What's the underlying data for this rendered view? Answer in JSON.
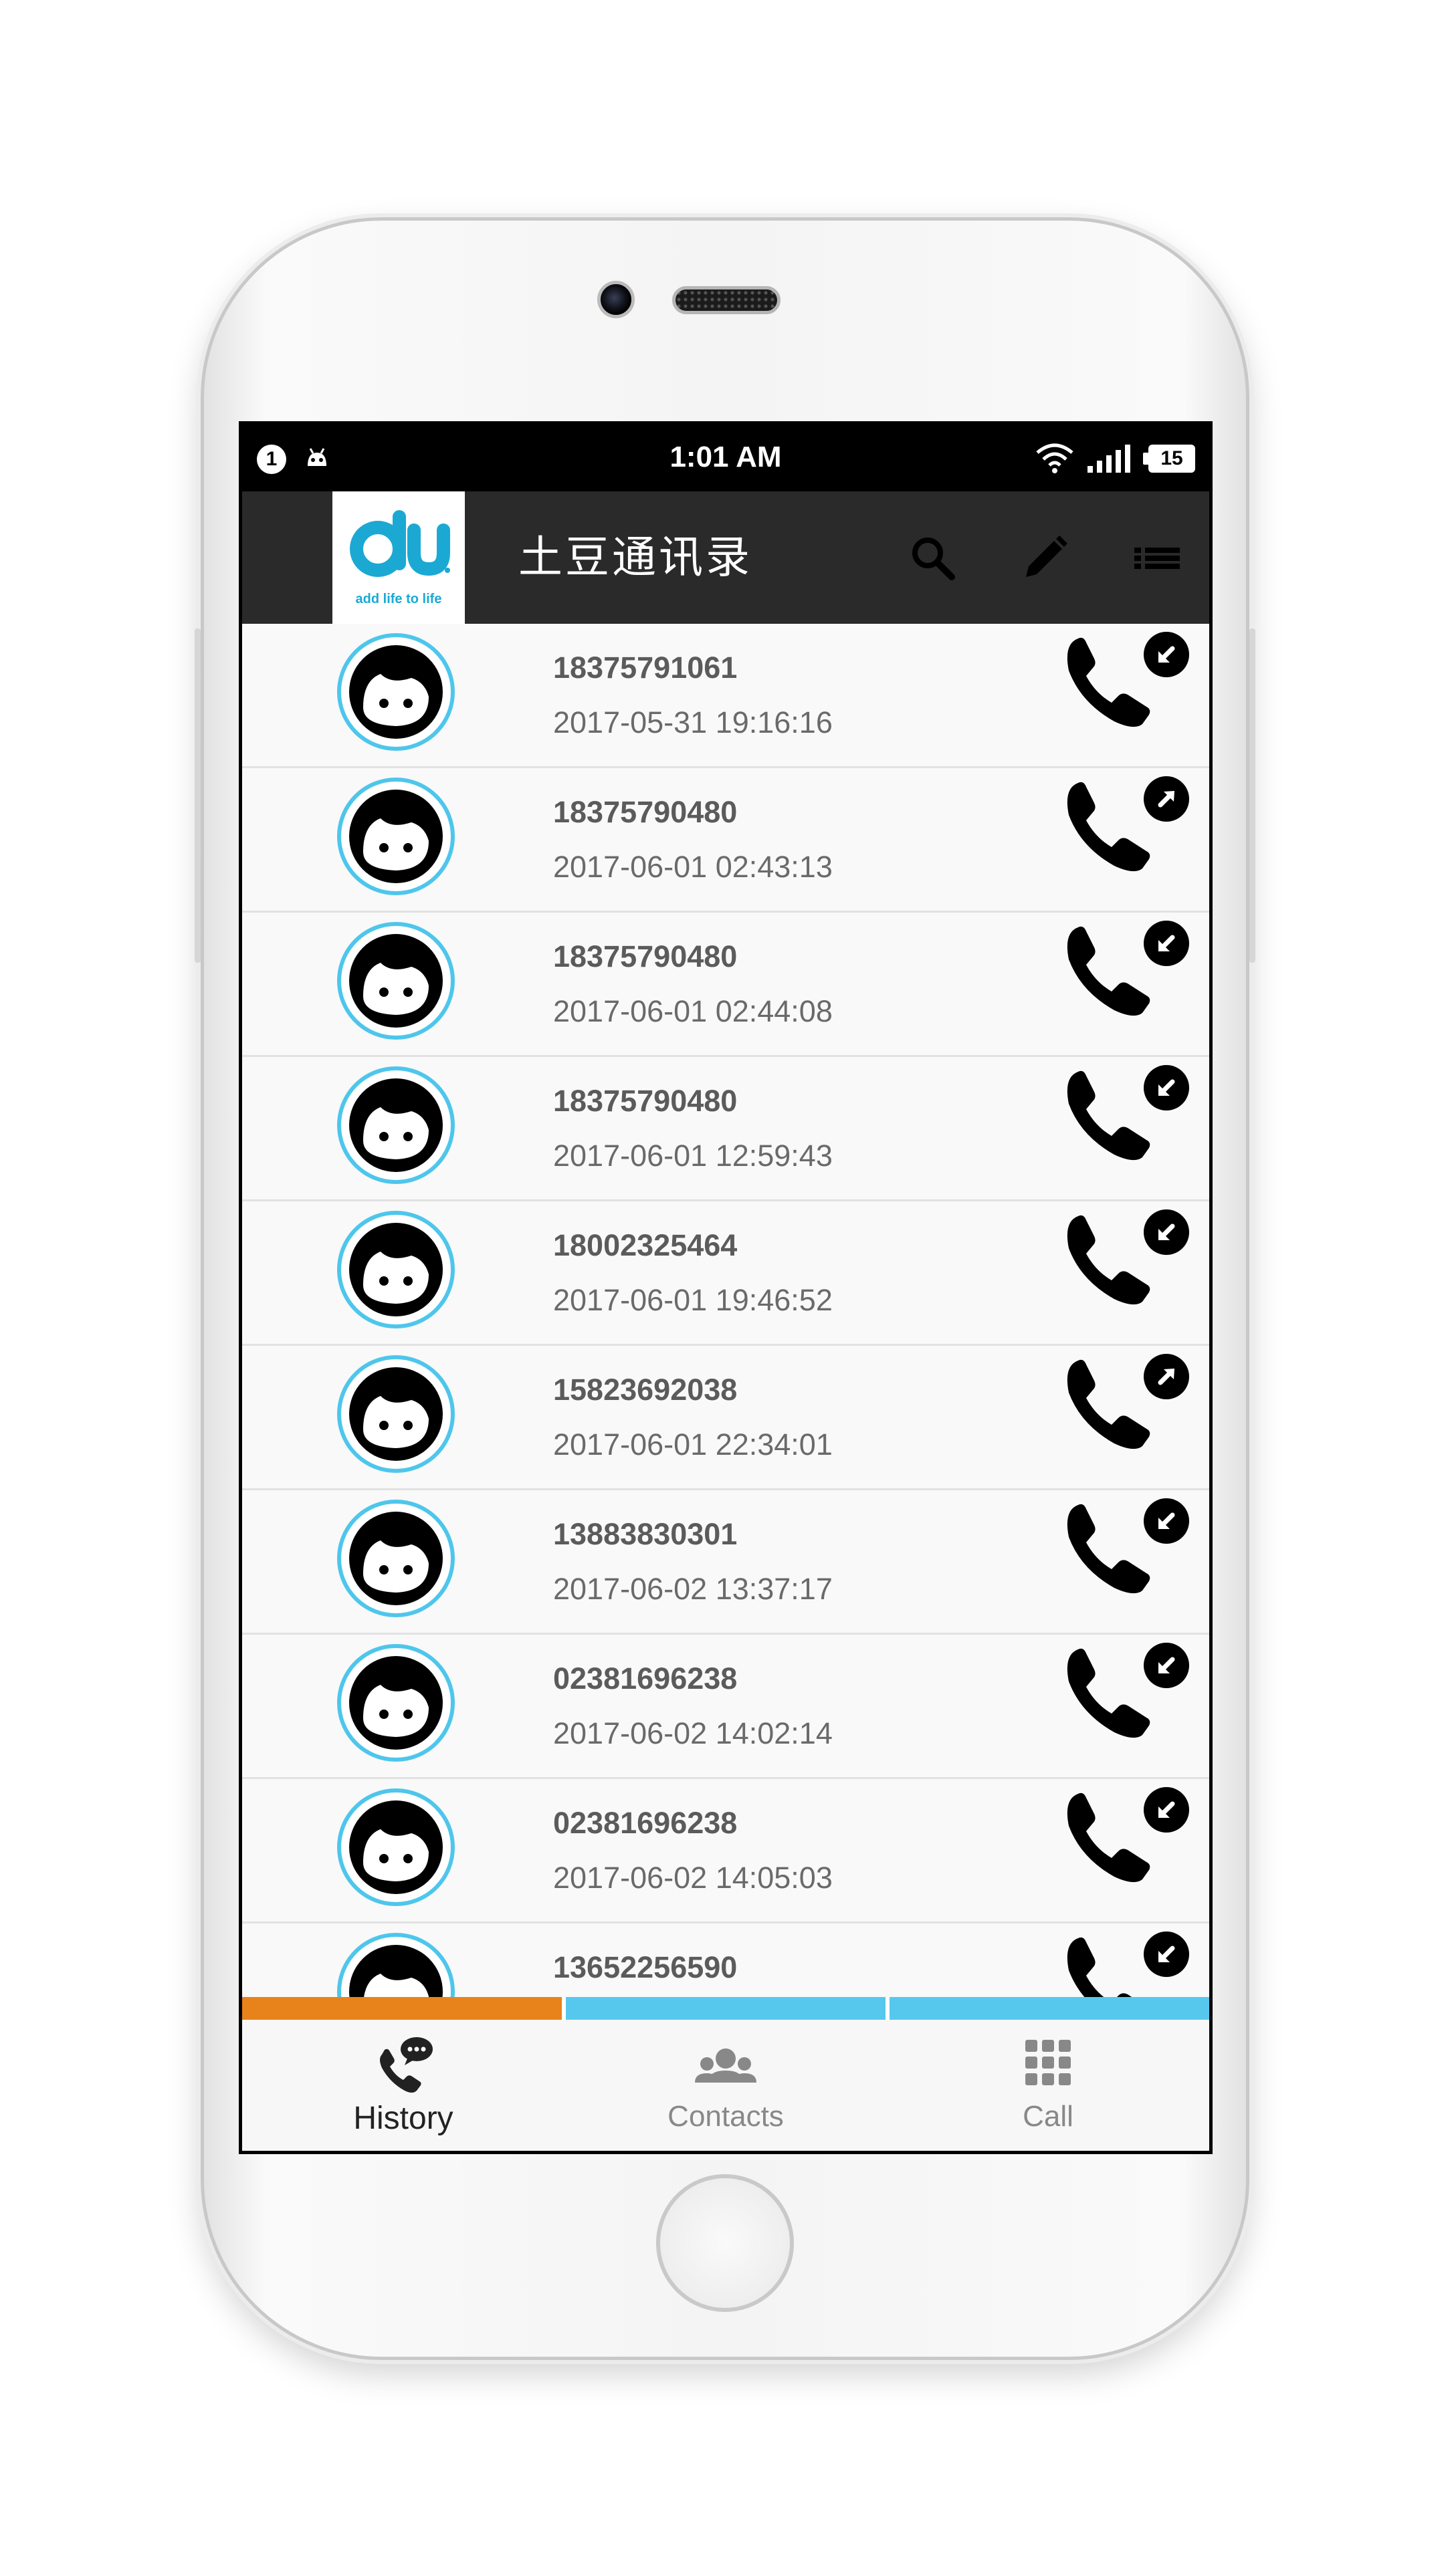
{
  "statusbar": {
    "notification_count": "1",
    "time": "1:01 AM",
    "battery": "15"
  },
  "appbar": {
    "logo_text": "du",
    "logo_tagline": "add life to life",
    "title": "土豆通讯录",
    "actions": [
      "search-icon",
      "pencil-icon",
      "list-menu-icon"
    ]
  },
  "calls": [
    {
      "number": "18375791061",
      "datetime": "2017-05-31 19:16:16",
      "direction": "incoming"
    },
    {
      "number": "18375790480",
      "datetime": "2017-06-01 02:43:13",
      "direction": "outgoing"
    },
    {
      "number": "18375790480",
      "datetime": "2017-06-01 02:44:08",
      "direction": "incoming"
    },
    {
      "number": "18375790480",
      "datetime": "2017-06-01 12:59:43",
      "direction": "incoming"
    },
    {
      "number": "18002325464",
      "datetime": "2017-06-01 19:46:52",
      "direction": "incoming"
    },
    {
      "number": "15823692038",
      "datetime": "2017-06-01 22:34:01",
      "direction": "outgoing"
    },
    {
      "number": "13883830301",
      "datetime": "2017-06-02 13:37:17",
      "direction": "incoming"
    },
    {
      "number": "02381696238",
      "datetime": "2017-06-02 14:02:14",
      "direction": "incoming"
    },
    {
      "number": "02381696238",
      "datetime": "2017-06-02 14:05:03",
      "direction": "incoming"
    },
    {
      "number": "13652256590",
      "datetime": "",
      "direction": "incoming"
    }
  ],
  "tabs": [
    {
      "label": "History",
      "icon": "phone-chat-icon",
      "active": true
    },
    {
      "label": "Contacts",
      "icon": "contacts-group-icon",
      "active": false
    },
    {
      "label": "Call",
      "icon": "dialpad-icon",
      "active": false
    }
  ],
  "colors": {
    "appbar": "#2a2a2a",
    "avatar_ring": "#4ec6ec",
    "tab_active": "#e8821a",
    "tab_inactive": "#56c8ee",
    "logo_blue": "#1ba9d4"
  }
}
